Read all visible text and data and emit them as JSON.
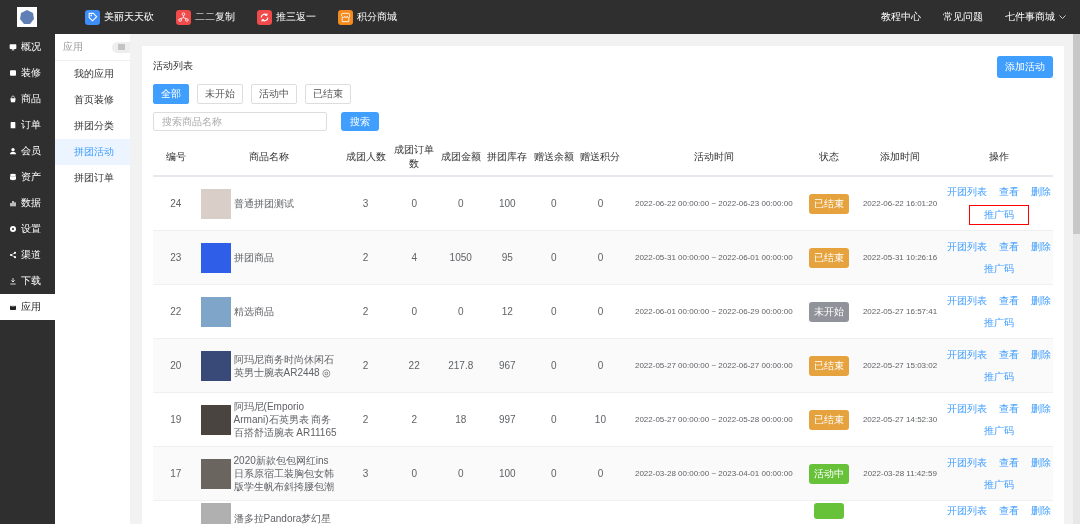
{
  "topbar": {
    "apps": [
      {
        "label": "美丽天天砍",
        "color": "#3d8ef7"
      },
      {
        "label": "二二复制",
        "color": "#f04a4a"
      },
      {
        "label": "推三返一",
        "color": "#f04a4a"
      },
      {
        "label": "积分商城",
        "color": "#f58b1f"
      }
    ],
    "links": [
      "教程中心",
      "常见问题"
    ],
    "account": "七件事商城"
  },
  "sidebar": {
    "items": [
      {
        "label": "概况",
        "selected": false
      },
      {
        "label": "装修",
        "selected": false
      },
      {
        "label": "商品",
        "selected": false
      },
      {
        "label": "订单",
        "selected": false
      },
      {
        "label": "会员",
        "selected": false
      },
      {
        "label": "资产",
        "selected": false
      },
      {
        "label": "数据",
        "selected": false
      },
      {
        "label": "设置",
        "selected": false
      },
      {
        "label": "渠道",
        "selected": false
      },
      {
        "label": "下载",
        "selected": false
      },
      {
        "label": "应用",
        "selected": true
      }
    ]
  },
  "subnav": {
    "title": "应用",
    "items": [
      {
        "label": "我的应用",
        "selected": false
      },
      {
        "label": "首页装修",
        "selected": false
      },
      {
        "label": "拼团分类",
        "selected": false
      },
      {
        "label": "拼团活动",
        "selected": true
      },
      {
        "label": "拼团订单",
        "selected": false
      }
    ]
  },
  "page": {
    "title": "活动列表",
    "add_button": "添加活动",
    "filters": [
      {
        "label": "全部",
        "selected": true
      },
      {
        "label": "未开始",
        "selected": false
      },
      {
        "label": "活动中",
        "selected": false
      },
      {
        "label": "已结束",
        "selected": false
      }
    ],
    "search": {
      "placeholder": "搜索商品名称",
      "button": "搜索"
    }
  },
  "table": {
    "columns": [
      "编号",
      "商品名称",
      "成团人数",
      "成团订单数",
      "成团金额",
      "拼团库存",
      "赠送余额",
      "赠送积分",
      "活动时间",
      "状态",
      "添加时间",
      "操作"
    ],
    "rows": [
      {
        "id": "24",
        "name": "普通拼团测试",
        "people": "3",
        "orders": "0",
        "amount": "0",
        "stock": "100",
        "balance": "0",
        "points": "0",
        "period": "2022-06-22 00:00:00 ~ 2022-06-23 00:00:00",
        "status": {
          "label": "已结束",
          "kind": "ended"
        },
        "added": "2022-06-22 16:01:20",
        "actions": [
          "开团列表",
          "查看",
          "删除"
        ],
        "promo": {
          "label": "推广码",
          "highlighted": true
        }
      },
      {
        "id": "23",
        "name": "拼团商品",
        "people": "2",
        "orders": "4",
        "amount": "1050",
        "stock": "95",
        "balance": "0",
        "points": "0",
        "period": "2022-05-31 00:00:00 ~ 2022-06-01 00:00:00",
        "status": {
          "label": "已结束",
          "kind": "ended"
        },
        "added": "2022-05-31 10:26:16",
        "actions": [
          "开团列表",
          "查看",
          "删除"
        ],
        "promo": {
          "label": "推广码",
          "highlighted": false
        }
      },
      {
        "id": "22",
        "name": "精选商品",
        "people": "2",
        "orders": "0",
        "amount": "0",
        "stock": "12",
        "balance": "0",
        "points": "0",
        "period": "2022-06-01 00:00:00 ~ 2022-06-29 00:00:00",
        "status": {
          "label": "未开始",
          "kind": "pending"
        },
        "added": "2022-05-27 16:57:41",
        "actions": [
          "开团列表",
          "查看",
          "删除"
        ],
        "promo": {
          "label": "推广码",
          "highlighted": false
        }
      },
      {
        "id": "20",
        "name": "阿玛尼商务时尚休闲石英男士腕表AR2448 ◎",
        "people": "2",
        "orders": "22",
        "amount": "217.8",
        "stock": "967",
        "balance": "0",
        "points": "0",
        "period": "2022-05-27 00:00:00 ~ 2022-06-27 00:00:00",
        "status": {
          "label": "已结束",
          "kind": "ended"
        },
        "added": "2022-05-27 15:03:02",
        "actions": [
          "开团列表",
          "查看",
          "删除"
        ],
        "promo": {
          "label": "推广码",
          "highlighted": false
        }
      },
      {
        "id": "19",
        "name": "阿玛尼(Emporio Armani)石英男表 商务百搭舒适腕表 AR11165",
        "people": "2",
        "orders": "2",
        "amount": "18",
        "stock": "997",
        "balance": "0",
        "points": "10",
        "period": "2022-05-27 00:00:00 ~ 2022-05-28 00:00:00",
        "status": {
          "label": "已结束",
          "kind": "ended"
        },
        "added": "2022-05-27 14:52:30",
        "actions": [
          "开团列表",
          "查看",
          "删除"
        ],
        "promo": {
          "label": "推广码",
          "highlighted": false
        }
      },
      {
        "id": "17",
        "name": "2020新款包包网红ins日系原宿工装胸包女韩版学生帆布斜挎腰包潮",
        "people": "3",
        "orders": "0",
        "amount": "0",
        "stock": "100",
        "balance": "0",
        "points": "0",
        "period": "2022-03-28 00:00:00 ~ 2023-04-01 00:00:00",
        "status": {
          "label": "活动中",
          "kind": "active"
        },
        "added": "2022-03-28 11:42:59",
        "actions": [
          "开团列表",
          "查看",
          "删除"
        ],
        "promo": {
          "label": "推广码",
          "highlighted": false
        }
      },
      {
        "name": "潘多拉Pandora梦幻星",
        "status": {
          "kind": "active"
        },
        "actions": [
          "开团列表",
          "查看",
          "删除"
        ]
      }
    ]
  }
}
